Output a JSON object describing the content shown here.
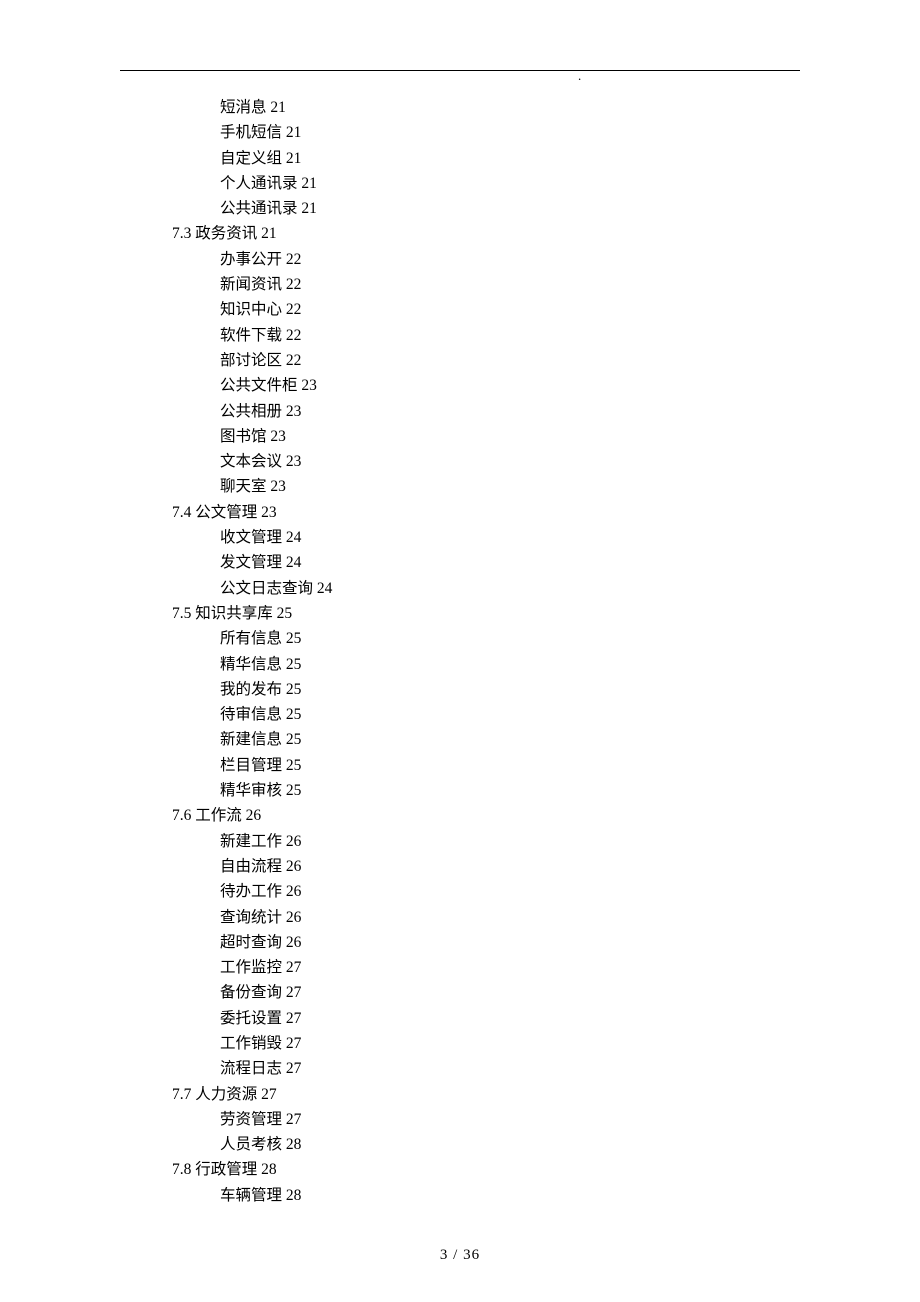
{
  "header": {
    "mark": "."
  },
  "footer": {
    "page": "3 / 36"
  },
  "toc": {
    "items": [
      {
        "level": "sub",
        "label": "短消息 21"
      },
      {
        "level": "sub",
        "label": "手机短信 21"
      },
      {
        "level": "sub",
        "label": "自定义组 21"
      },
      {
        "level": "sub",
        "label": "个人通讯录 21"
      },
      {
        "level": "sub",
        "label": "公共通讯录 21"
      },
      {
        "level": "section",
        "label": "7.3 政务资讯 21"
      },
      {
        "level": "sub",
        "label": "办事公开 22"
      },
      {
        "level": "sub",
        "label": "新闻资讯 22"
      },
      {
        "level": "sub",
        "label": "知识中心 22"
      },
      {
        "level": "sub",
        "label": "软件下载 22"
      },
      {
        "level": "sub",
        "label": "部讨论区 22"
      },
      {
        "level": "sub",
        "label": "公共文件柜 23"
      },
      {
        "level": "sub",
        "label": "公共相册 23"
      },
      {
        "level": "sub",
        "label": "图书馆 23"
      },
      {
        "level": "sub",
        "label": "文本会议 23"
      },
      {
        "level": "sub",
        "label": "聊天室 23"
      },
      {
        "level": "section",
        "label": "7.4 公文管理 23"
      },
      {
        "level": "sub",
        "label": "收文管理 24"
      },
      {
        "level": "sub",
        "label": "发文管理 24"
      },
      {
        "level": "sub",
        "label": "公文日志查询 24"
      },
      {
        "level": "section",
        "label": "7.5 知识共享库 25"
      },
      {
        "level": "sub",
        "label": "所有信息 25"
      },
      {
        "level": "sub",
        "label": "精华信息 25"
      },
      {
        "level": "sub",
        "label": "我的发布 25"
      },
      {
        "level": "sub",
        "label": "待审信息 25"
      },
      {
        "level": "sub",
        "label": "新建信息 25"
      },
      {
        "level": "sub",
        "label": "栏目管理 25"
      },
      {
        "level": "sub",
        "label": "精华审核 25"
      },
      {
        "level": "section",
        "label": "7.6 工作流 26"
      },
      {
        "level": "sub",
        "label": "新建工作 26"
      },
      {
        "level": "sub",
        "label": "自由流程 26"
      },
      {
        "level": "sub",
        "label": "待办工作 26"
      },
      {
        "level": "sub",
        "label": "查询统计 26"
      },
      {
        "level": "sub",
        "label": "超时查询 26"
      },
      {
        "level": "sub",
        "label": "工作监控 27"
      },
      {
        "level": "sub",
        "label": "备份查询 27"
      },
      {
        "level": "sub",
        "label": "委托设置 27"
      },
      {
        "level": "sub",
        "label": "工作销毁 27"
      },
      {
        "level": "sub",
        "label": "流程日志 27"
      },
      {
        "level": "section",
        "label": "7.7 人力资源 27"
      },
      {
        "level": "sub",
        "label": "劳资管理 27"
      },
      {
        "level": "sub",
        "label": "人员考核 28"
      },
      {
        "level": "section",
        "label": "7.8 行政管理 28"
      },
      {
        "level": "sub",
        "label": "车辆管理 28"
      }
    ]
  }
}
